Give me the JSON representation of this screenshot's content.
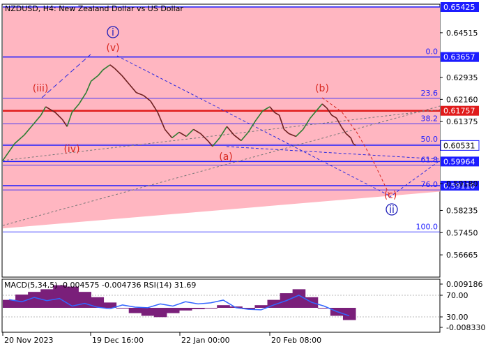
{
  "title": "NZDUSD, H4:  New Zealand Dollar vs US Dollar",
  "chart_data": {
    "type": "line",
    "symbol": "NZDUSD",
    "timeframe": "H4",
    "ylim": [
      0.56,
      0.6542
    ],
    "grid": false,
    "x_labels": [
      "20 Nov 2023",
      "19 Dec 16:00",
      "22 Jan 00:00",
      "20 Feb 08:00"
    ],
    "y_ticks": [
      "0.64515",
      "0.62935",
      "0.62160",
      "0.61375",
      "0.59180",
      "0.58235",
      "0.57450",
      "0.56665"
    ],
    "price_tags": [
      {
        "value": 0.65425,
        "label": "0.65425",
        "color": "#1c1cff"
      },
      {
        "value": 0.63657,
        "label": "0.63657",
        "color": "#1c1cff"
      },
      {
        "value": 0.61757,
        "label": "0.61757",
        "color": "#e01b1b"
      },
      {
        "value": 0.60531,
        "label": "0.60531",
        "color": "#1c1cff",
        "style": "outline"
      },
      {
        "value": 0.59964,
        "label": "0.59964",
        "color": "#1c1cff"
      },
      {
        "value": 0.5911,
        "label": "0.59110",
        "color": "#1c1cff"
      }
    ],
    "fibonacci_levels": [
      {
        "label": "0.0",
        "value": 0.63657
      },
      {
        "label": "23.6",
        "value": 0.62197
      },
      {
        "label": "38.2",
        "value": 0.61296
      },
      {
        "label": "50.0",
        "value": 0.60567
      },
      {
        "label": "61.8",
        "value": 0.59836
      },
      {
        "label": "76.0",
        "value": 0.58959
      },
      {
        "label": "100.0",
        "value": 0.57475
      }
    ],
    "wave_labels": [
      {
        "text": "i",
        "color": "#1c1cb8",
        "circled": true
      },
      {
        "text": "(v)",
        "color": "#d8261e"
      },
      {
        "text": "(iii)",
        "color": "#d8261e"
      },
      {
        "text": "(iv)",
        "color": "#d8261e"
      },
      {
        "text": "(a)",
        "color": "#d8261e"
      },
      {
        "text": "(b)",
        "color": "#d8261e"
      },
      {
        "text": "(c)",
        "color": "#d8261e"
      },
      {
        "text": "ii",
        "color": "#1c1cb8",
        "circled": true
      }
    ],
    "price_series": [
      {
        "x": 0,
        "y": 0.6
      },
      {
        "x": 5,
        "y": 0.606
      },
      {
        "x": 9,
        "y": 0.609
      },
      {
        "x": 13,
        "y": 0.613
      },
      {
        "x": 16,
        "y": 0.616
      },
      {
        "x": 18,
        "y": 0.619
      },
      {
        "x": 22,
        "y": 0.617
      },
      {
        "x": 25,
        "y": 0.6145
      },
      {
        "x": 27,
        "y": 0.612
      },
      {
        "x": 29,
        "y": 0.617
      },
      {
        "x": 32,
        "y": 0.62
      },
      {
        "x": 35,
        "y": 0.624
      },
      {
        "x": 37,
        "y": 0.628
      },
      {
        "x": 40,
        "y": 0.63
      },
      {
        "x": 42,
        "y": 0.632
      },
      {
        "x": 45,
        "y": 0.6338
      },
      {
        "x": 47,
        "y": 0.6325
      },
      {
        "x": 50,
        "y": 0.63
      },
      {
        "x": 53,
        "y": 0.627
      },
      {
        "x": 56,
        "y": 0.624
      },
      {
        "x": 59,
        "y": 0.623
      },
      {
        "x": 62,
        "y": 0.621
      },
      {
        "x": 65,
        "y": 0.617
      },
      {
        "x": 68,
        "y": 0.611
      },
      {
        "x": 71,
        "y": 0.608
      },
      {
        "x": 74,
        "y": 0.61
      },
      {
        "x": 77,
        "y": 0.6085
      },
      {
        "x": 80,
        "y": 0.611
      },
      {
        "x": 83,
        "y": 0.6095
      },
      {
        "x": 86,
        "y": 0.607
      },
      {
        "x": 88,
        "y": 0.605
      },
      {
        "x": 91,
        "y": 0.608
      },
      {
        "x": 94,
        "y": 0.612
      },
      {
        "x": 97,
        "y": 0.609
      },
      {
        "x": 100,
        "y": 0.607
      },
      {
        "x": 103,
        "y": 0.61
      },
      {
        "x": 106,
        "y": 0.614
      },
      {
        "x": 109,
        "y": 0.6175
      },
      {
        "x": 112,
        "y": 0.619
      },
      {
        "x": 114,
        "y": 0.617
      },
      {
        "x": 116,
        "y": 0.616
      },
      {
        "x": 118,
        "y": 0.611
      },
      {
        "x": 120,
        "y": 0.6095
      },
      {
        "x": 123,
        "y": 0.6085
      },
      {
        "x": 126,
        "y": 0.611
      },
      {
        "x": 129,
        "y": 0.615
      },
      {
        "x": 132,
        "y": 0.618
      },
      {
        "x": 134,
        "y": 0.62
      },
      {
        "x": 136,
        "y": 0.6185
      },
      {
        "x": 138,
        "y": 0.616
      },
      {
        "x": 140,
        "y": 0.615
      },
      {
        "x": 142,
        "y": 0.612
      },
      {
        "x": 144,
        "y": 0.6095
      },
      {
        "x": 146,
        "y": 0.608
      },
      {
        "x": 147,
        "y": 0.606
      },
      {
        "x": 148,
        "y": 0.6053
      }
    ],
    "indicator": {
      "label": "MACD(5,34,5) -0.004575 -0.004736 RSI(14) 31.69",
      "y_ticks": [
        "0.009186",
        "70.00",
        "30.00",
        "-0.008330"
      ],
      "macd": [
        0.003,
        0.005,
        0.006,
        0.007,
        0.0085,
        0.008,
        0.006,
        0.004,
        0.002,
        0.0,
        -0.002,
        -0.003,
        -0.0035,
        -0.002,
        -0.001,
        -0.0005,
        0.0,
        0.001,
        0.0005,
        -0.0005,
        0.001,
        0.003,
        0.0055,
        0.007,
        0.004,
        0.0,
        -0.003,
        -0.0046
      ],
      "rsi": [
        62,
        58,
        66,
        60,
        64,
        50,
        55,
        48,
        45,
        52,
        48,
        47,
        54,
        50,
        58,
        54,
        56,
        61,
        47,
        44,
        43,
        52,
        60,
        70,
        57,
        50,
        40,
        32
      ]
    }
  }
}
